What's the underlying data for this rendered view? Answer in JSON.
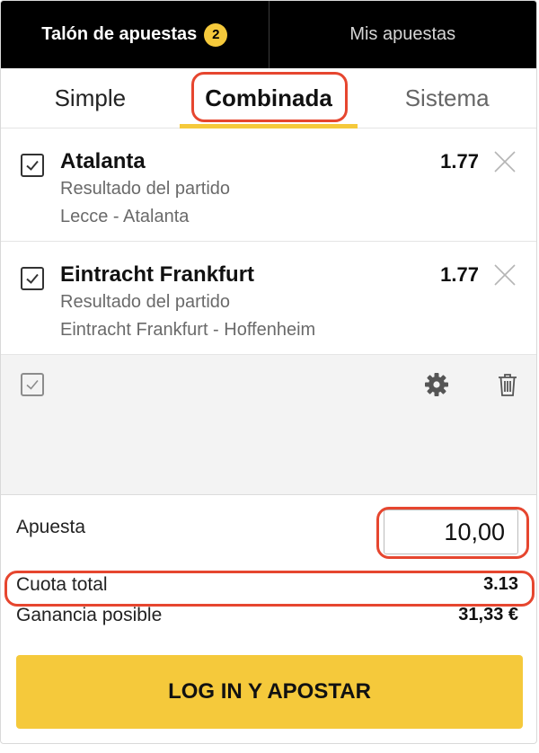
{
  "header": {
    "tab_betslip": "Talón de apuestas",
    "betslip_count": "2",
    "tab_mybets": "Mis apuestas"
  },
  "bet_types": {
    "simple": "Simple",
    "combined": "Combinada",
    "system": "Sistema"
  },
  "selections": [
    {
      "team": "Atalanta",
      "market": "Resultado del partido",
      "match": "Lecce - Atalanta",
      "odds": "1.77"
    },
    {
      "team": "Eintracht Frankfurt",
      "market": "Resultado del partido",
      "match": "Eintracht Frankfurt - Hoffenheim",
      "odds": "1.77"
    }
  ],
  "stake": {
    "label": "Apuesta",
    "value": "10,00"
  },
  "summary": {
    "total_odds_label": "Cuota total",
    "total_odds_value": "3.13",
    "potential_win_label": "Ganancia posible",
    "potential_win_value": "31,33 €"
  },
  "cta_label": "LOG IN Y APOSTAR",
  "colors": {
    "accent": "#f5c93b",
    "header_bg": "#000000",
    "highlight": "#e6462f"
  },
  "icons": {
    "checkbox": "checkbox-checked-icon",
    "close": "close-icon",
    "settings": "gear-icon",
    "delete": "trash-icon"
  }
}
